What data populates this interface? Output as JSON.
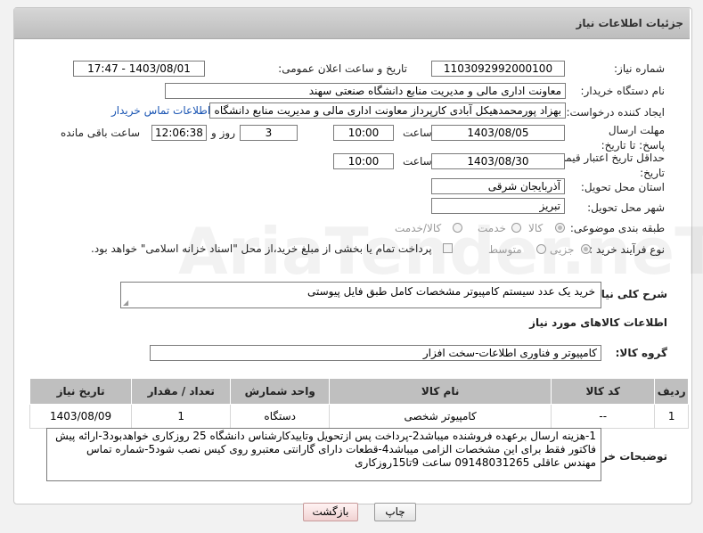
{
  "header": {
    "title": "جزئیات اطلاعات نیاز"
  },
  "fields": {
    "need_number_label": "شماره نیاز:",
    "need_number": "1103092992000100",
    "announce_label": "تاریخ و ساعت اعلان عمومی:",
    "announce_value": "1403/08/01 - 17:47",
    "buyer_org_label": "نام دستگاه خریدار:",
    "buyer_org": "معاونت اداری  مالی و مدیریت منابع دانشگاه صنعتی سهند",
    "requester_label": "ایجاد کننده درخواست:",
    "requester": "بهزاد پورمحمدهیکل آبادی کارپرداز معاونت اداری  مالی و مدیریت منابع دانشگاه صنعتی سهند",
    "contact_link": "اطلاعات تماس خریدار",
    "reply_deadline_label": "مهلت ارسال پاسخ: تا تاریخ:",
    "reply_date": "1403/08/05",
    "time_label": "ساعت",
    "reply_time": "10:00",
    "days_value": "3",
    "days_label": "روز و",
    "remaining_time": "12:06:38",
    "remaining_label": "ساعت باقی مانده",
    "price_validity_label": "حداقل تاریخ اعتبار قیمت: تا تاریخ:",
    "price_date": "1403/08/30",
    "price_time": "10:00",
    "province_label": "استان محل تحویل:",
    "province": "آذربایجان شرقی",
    "city_label": "شهر محل تحویل:",
    "city": "تبریز",
    "category_label": "طبقه بندی موضوعی:",
    "category_options": [
      "کالا",
      "خدمت",
      "کالا/خدمت"
    ],
    "process_label": "نوع فرآیند خرید :",
    "process_options": [
      "جزیی",
      "متوسط"
    ],
    "payment_note": "پرداخت تمام یا بخشی از مبلغ خرید،از محل \"اسناد خزانه اسلامی\" خواهد بود.",
    "description_label": "شرح کلی نیاز:",
    "description": "خرید یک عدد سیستم کامپیوتر مشخصات کامل طبق فایل پیوستی"
  },
  "goods": {
    "section_title": "اطلاعات کالاهای مورد نیاز",
    "group_label": "گروه کالا:",
    "group_value": "کامپیوتر و فناوری اطلاعات-سخت افزار",
    "columns": [
      "ردیف",
      "کد کالا",
      "نام کالا",
      "واحد شمارش",
      "تعداد / مقدار",
      "تاریخ نیاز"
    ],
    "rows": [
      {
        "row": "1",
        "code": "--",
        "name": "کامپیوتر شخصی",
        "unit": "دستگاه",
        "qty": "1",
        "date": "1403/08/09"
      }
    ]
  },
  "buyer_notes": {
    "label": "توضیحات خریدار:",
    "text": "1-هزینه ارسال برعهده فروشنده میباشد2-پرداخت پس ازتحویل وتاییدکارشناس دانشگاه 25 روزکاری خواهدبود3-ارائه پیش فاکتور فقط برای این مشخصات الزامی میباشد4-قطعات دارای گارانتی معتبرو روی کیس نصب شود5-شماره تماس مهندس عاقلی 09148031265 ساعت 9تا15روزکاری"
  },
  "buttons": {
    "print": "چاپ",
    "back": "بازگشت"
  }
}
